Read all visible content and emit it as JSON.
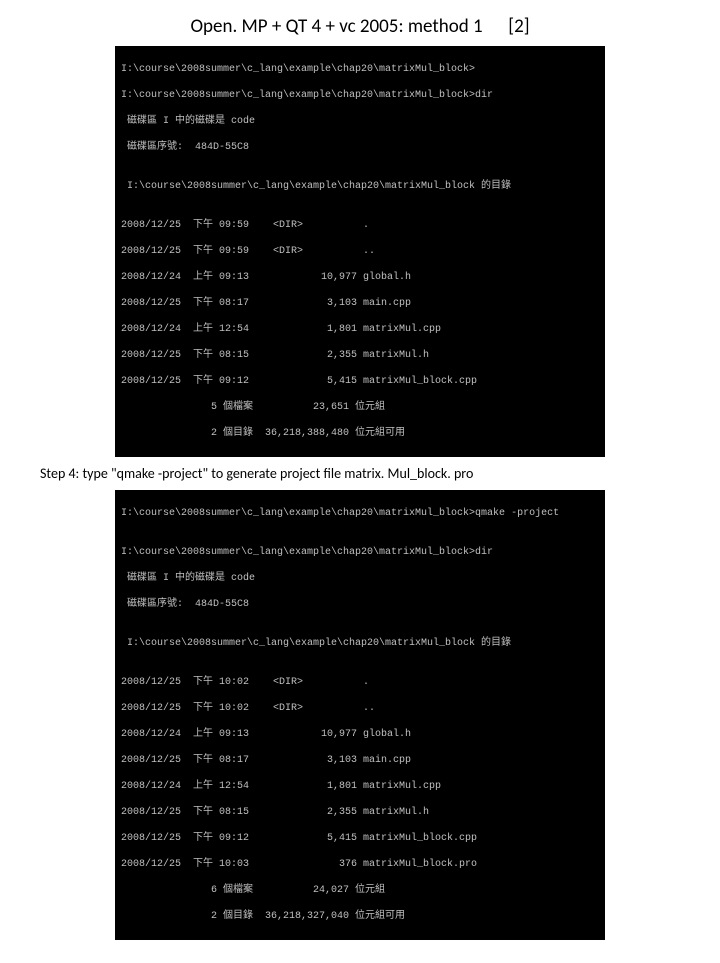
{
  "header": {
    "title": "Open. MP + QT 4 + vc 2005: method 1",
    "page_marker": "[2]"
  },
  "terminal1": {
    "l1": "I:\\course\\2008summer\\c_lang\\example\\chap20\\matrixMul_block>",
    "l2": "I:\\course\\2008summer\\c_lang\\example\\chap20\\matrixMul_block>dir",
    "l3": " 磁碟區 I 中的磁碟是 code",
    "l4": " 磁碟區序號:  484D-55C8",
    "l5": "",
    "l6": " I:\\course\\2008summer\\c_lang\\example\\chap20\\matrixMul_block 的目錄",
    "l7": "",
    "r1": "2008/12/25  下午 09:59    <DIR>          .",
    "r2": "2008/12/25  下午 09:59    <DIR>          ..",
    "r3": "2008/12/24  上午 09:13            10,977 global.h",
    "r4": "2008/12/25  下午 08:17             3,103 main.cpp",
    "r5": "2008/12/24  上午 12:54             1,801 matrixMul.cpp",
    "r6": "2008/12/25  下午 08:15             2,355 matrixMul.h",
    "r7": "2008/12/25  下午 09:12             5,415 matrixMul_block.cpp",
    "r8": "               5 個檔案          23,651 位元組",
    "r9": "               2 個目錄  36,218,388,480 位元組可用"
  },
  "step4": "Step 4: type \"qmake -project\" to generate project file matrix. Mul_block. pro",
  "terminal2": {
    "l1": "I:\\course\\2008summer\\c_lang\\example\\chap20\\matrixMul_block>qmake -project",
    "l2": "",
    "l3": "I:\\course\\2008summer\\c_lang\\example\\chap20\\matrixMul_block>dir",
    "l4": " 磁碟區 I 中的磁碟是 code",
    "l5": " 磁碟區序號:  484D-55C8",
    "l6": "",
    "l7": " I:\\course\\2008summer\\c_lang\\example\\chap20\\matrixMul_block 的目錄",
    "l8": "",
    "r1": "2008/12/25  下午 10:02    <DIR>          .",
    "r2": "2008/12/25  下午 10:02    <DIR>          ..",
    "r3": "2008/12/24  上午 09:13            10,977 global.h",
    "r4": "2008/12/25  下午 08:17             3,103 main.cpp",
    "r5": "2008/12/24  上午 12:54             1,801 matrixMul.cpp",
    "r6": "2008/12/25  下午 08:15             2,355 matrixMul.h",
    "r7": "2008/12/25  下午 09:12             5,415 matrixMul_block.cpp",
    "r8": "2008/12/25  下午 10:03               376 matrixMul_block.pro",
    "r9": "               6 個檔案          24,027 位元組",
    "r10": "               2 個目錄  36,218,327,040 位元組可用"
  }
}
